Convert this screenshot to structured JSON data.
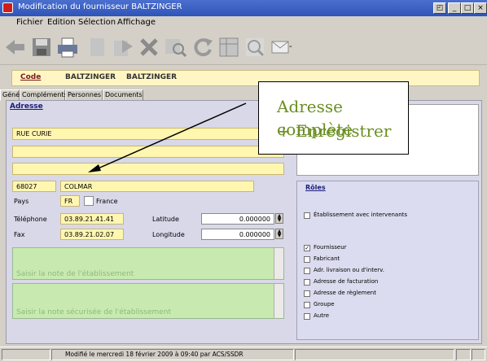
{
  "window": {
    "title": "Modification du fournisseur BALTZINGER",
    "app_icon": "app-icon"
  },
  "menu": {
    "items": [
      "Fichier",
      "Edition",
      "Sélection",
      "Affichage"
    ]
  },
  "toolbar": {
    "icons": [
      "back-icon",
      "save-icon",
      "print-icon",
      "blank-page-icon",
      "duplicate-icon",
      "delete-icon",
      "search-list-icon",
      "refresh-icon",
      "table-icon",
      "magnifier-icon",
      "email-icon"
    ]
  },
  "header": {
    "code_label": "Code",
    "code_value": "BALTZINGER",
    "name_value": "BALTZINGER"
  },
  "tabs": [
    "Général",
    "Compléments",
    "Personnes",
    "Documents"
  ],
  "address": {
    "section_label": "Adresse",
    "line1": "RUE CURIE",
    "line2": "",
    "line3": "",
    "postal_code": "68027",
    "city": "COLMAR",
    "country_label": "Pays",
    "country_code": "FR",
    "country_name": "France",
    "phone_label": "Téléphone",
    "phone": "03.89.21.41.41",
    "fax_label": "Fax",
    "fax": "03.89.21.02.07",
    "latitude_label": "Latitude",
    "latitude": "0.000000",
    "longitude_label": "Longitude",
    "longitude": "0.000000"
  },
  "notes": {
    "note_placeholder": "Saisir la note de l'établissement",
    "secure_note_placeholder": "Saisir la note sécurisée de l'établissement"
  },
  "roles": {
    "section_label": "Rôles",
    "establishment": {
      "label": "Établissement avec intervenants",
      "checked": false
    },
    "items": [
      {
        "label": "Fournisseur",
        "checked": true
      },
      {
        "label": "Fabricant",
        "checked": false
      },
      {
        "label": "Adr. livraison ou d'interv.",
        "checked": false
      },
      {
        "label": "Adresse de facturation",
        "checked": false
      },
      {
        "label": "Adresse de règlement",
        "checked": false
      },
      {
        "label": "Groupe",
        "checked": false
      },
      {
        "label": "Autre",
        "checked": false
      }
    ]
  },
  "status": {
    "text": "Modifié le mercredi 18 février 2009 à 09:40 par ACS/SSDR"
  },
  "annotation": {
    "line1": "Adresse complète",
    "line2": "+ Enregistrer"
  },
  "colors": {
    "field_yellow": "#fff6b0",
    "note_green": "#c8eab0",
    "titlebar_blue": "#2f54b8",
    "callout_text": "#6b8e23"
  }
}
